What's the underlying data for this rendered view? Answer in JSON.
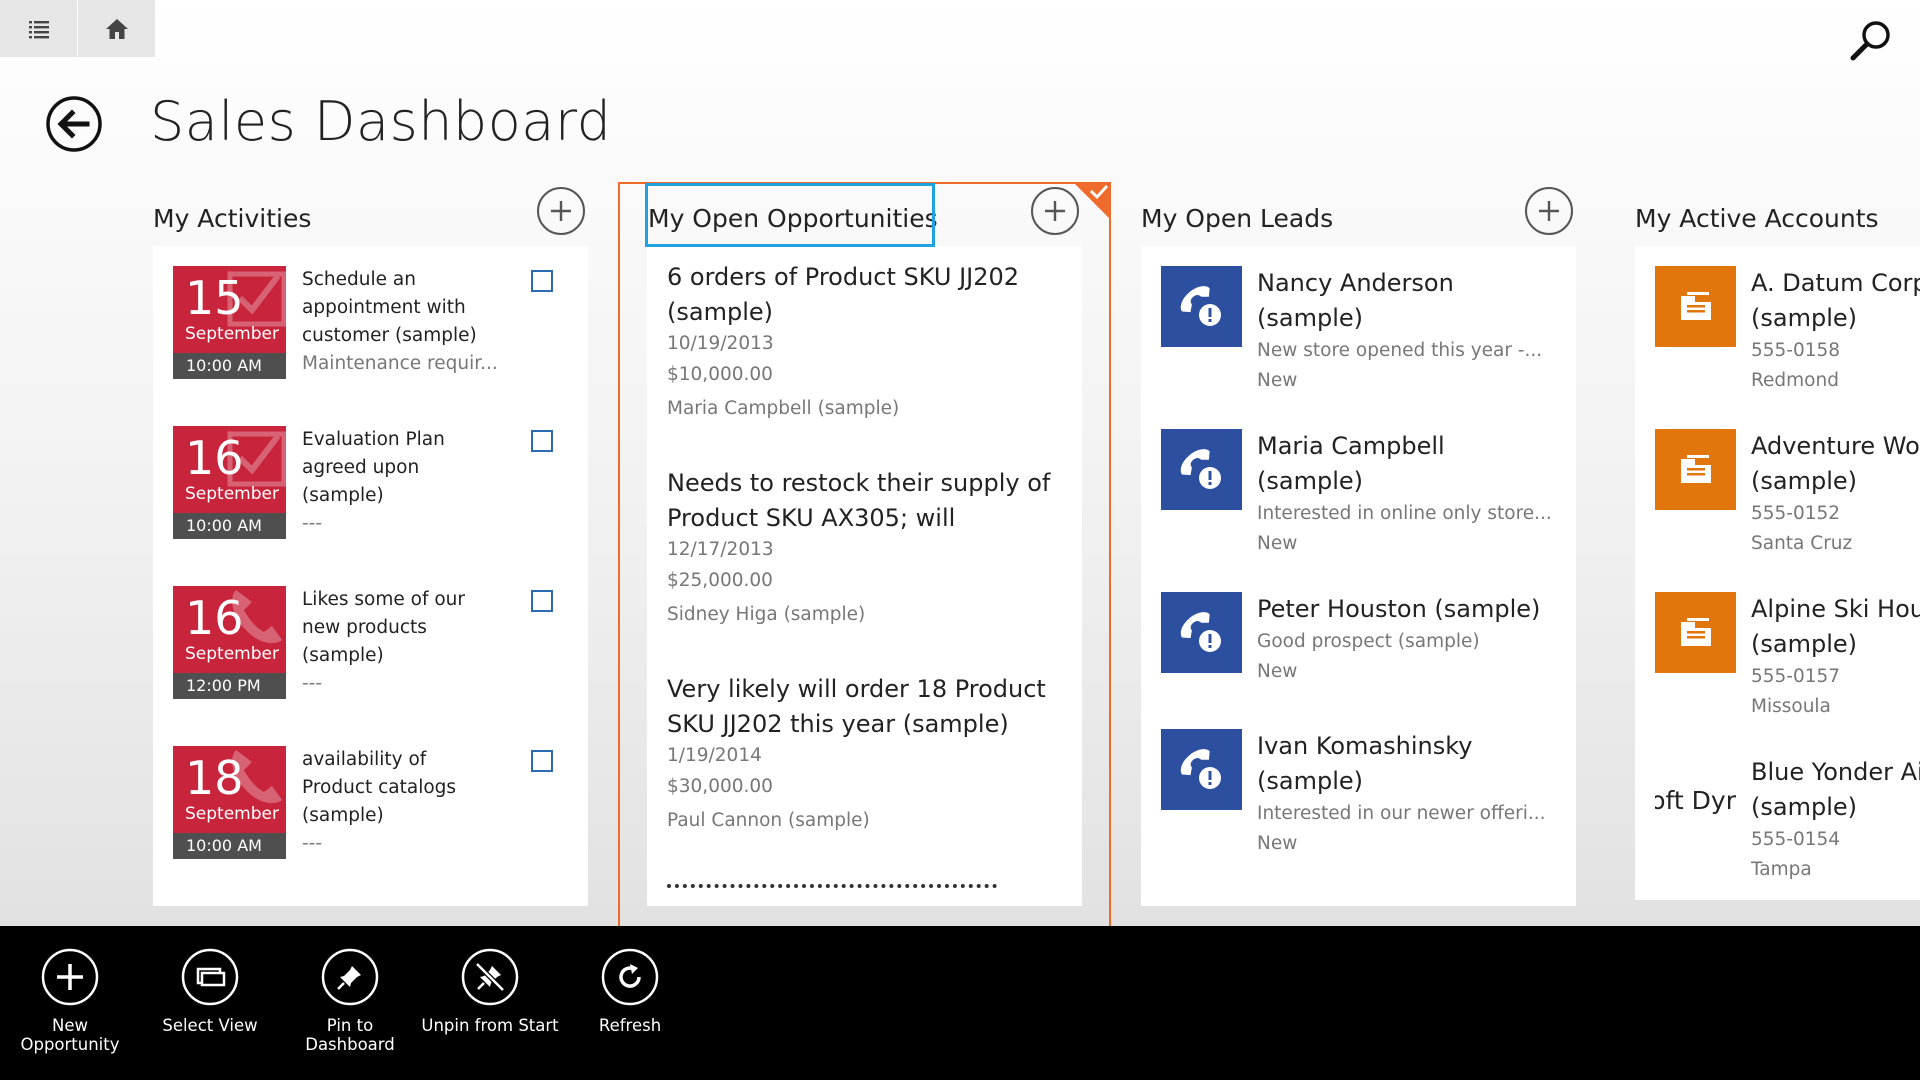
{
  "page": {
    "title": "Sales Dashboard"
  },
  "colors": {
    "activity_red": "#c8253d",
    "lead_blue": "#2d4fa0",
    "account_orange": "#e0760c",
    "selection_orange": "#ee6b2b",
    "focus_blue": "#1fa3de"
  },
  "activities": {
    "title": "My Activities",
    "items": [
      {
        "day": "15",
        "month": "September",
        "time": "10:00 AM",
        "icon": "calendar-check-icon",
        "lines": [
          "Schedule an",
          "appointment with",
          "customer (sample)"
        ],
        "sub": "Maintenance requir..."
      },
      {
        "day": "16",
        "month": "September",
        "time": "10:00 AM",
        "icon": "calendar-check-icon",
        "lines": [
          "Evaluation Plan",
          "agreed upon",
          "(sample)"
        ],
        "sub": "---"
      },
      {
        "day": "16",
        "month": "September",
        "time": "12:00 PM",
        "icon": "phone-icon",
        "lines": [
          "Likes some of our",
          "new products",
          "(sample)"
        ],
        "sub": "---"
      },
      {
        "day": "18",
        "month": "September",
        "time": "10:00 AM",
        "icon": "phone-icon",
        "lines": [
          "availability of",
          "Product catalogs",
          "(sample)"
        ],
        "sub": "---"
      }
    ]
  },
  "opportunities": {
    "title": "My Open Opportunities",
    "items": [
      {
        "title": [
          "6 orders of Product SKU JJ202",
          "(sample)"
        ],
        "date": "10/19/2013",
        "amount": "$10,000.00",
        "owner": "Maria Campbell (sample)"
      },
      {
        "title": [
          "Needs to restock their supply of",
          "Product SKU AX305; will"
        ],
        "date": "12/17/2013",
        "amount": "$25,000.00",
        "owner": "Sidney Higa (sample)"
      },
      {
        "title": [
          "Very likely will order 18 Product",
          "SKU JJ202 this year (sample)"
        ],
        "date": "1/19/2014",
        "amount": "$30,000.00",
        "owner": "Paul Cannon (sample)"
      }
    ]
  },
  "leads": {
    "title": "My Open Leads",
    "items": [
      {
        "name": [
          "Nancy Anderson",
          "(sample)"
        ],
        "desc": "New store opened this year -...",
        "status": "New"
      },
      {
        "name": [
          "Maria Campbell",
          "(sample)"
        ],
        "desc": "Interested in online only store...",
        "status": "New"
      },
      {
        "name": [
          "Peter Houston (sample)"
        ],
        "desc": "Good prospect (sample)",
        "status": "New"
      },
      {
        "name": [
          "Ivan Komashinsky",
          "(sample)"
        ],
        "desc": "Interested in our newer offeri...",
        "status": "New"
      }
    ]
  },
  "accounts": {
    "title": "My Active Accounts",
    "items": [
      {
        "name": [
          "A. Datum Corporation",
          "(sample)"
        ],
        "phone": "555-0158",
        "city": "Redmond",
        "logo_text": ""
      },
      {
        "name": [
          "Adventure Works",
          "(sample)"
        ],
        "phone": "555-0152",
        "city": "Santa Cruz",
        "logo_text": ""
      },
      {
        "name": [
          "Alpine Ski House",
          "(sample)"
        ],
        "phone": "555-0157",
        "city": "Missoula",
        "logo_text": ""
      },
      {
        "name": [
          "Blue Yonder Airlines",
          "(sample)"
        ],
        "phone": "555-0154",
        "city": "Tampa",
        "logo_text": "soft Dyr"
      }
    ]
  },
  "appbar": {
    "buttons": [
      {
        "label": "New\nOpportunity",
        "icon": "plus-icon"
      },
      {
        "label": "Select View",
        "icon": "select-view-icon"
      },
      {
        "label": "Pin to\nDashboard",
        "icon": "pin-icon"
      },
      {
        "label": "Unpin from Start",
        "icon": "unpin-icon"
      },
      {
        "label": "Refresh",
        "icon": "refresh-icon"
      }
    ]
  }
}
